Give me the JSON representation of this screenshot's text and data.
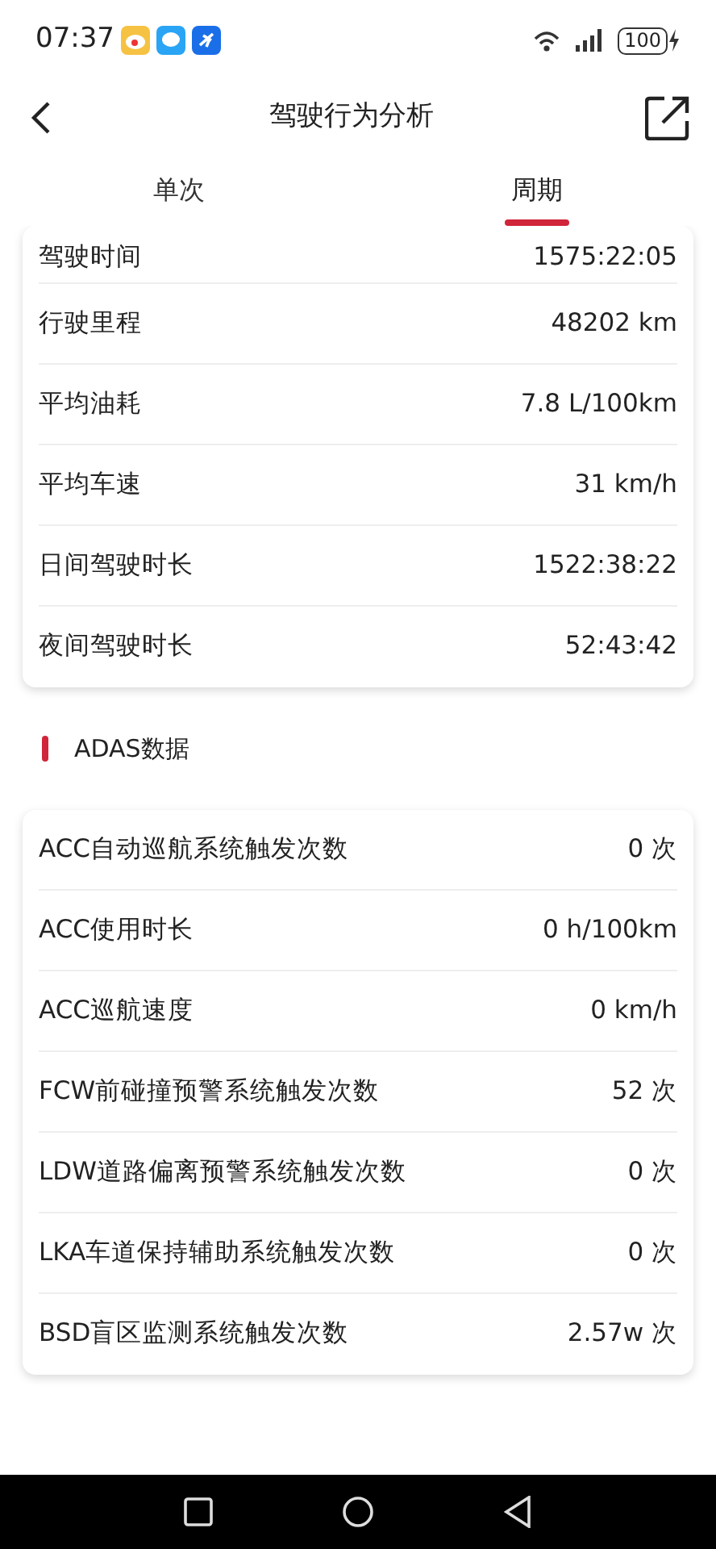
{
  "status_bar": {
    "time": "07:37",
    "battery": "100"
  },
  "header": {
    "title": "驾驶行为分析"
  },
  "tabs": [
    {
      "label": "单次",
      "selected": false
    },
    {
      "label": "周期",
      "selected": true
    }
  ],
  "summary": [
    {
      "label": "驾驶时间",
      "value": "1575:22:05"
    },
    {
      "label": "行驶里程",
      "value": "48202 km"
    },
    {
      "label": "平均油耗",
      "value": "7.8 L/100km"
    },
    {
      "label": "平均车速",
      "value": "31 km/h"
    },
    {
      "label": "日间驾驶时长",
      "value": "1522:38:22"
    },
    {
      "label": "夜间驾驶时长",
      "value": "52:43:42"
    }
  ],
  "adas": {
    "title": "ADAS数据",
    "rows": [
      {
        "label": "ACC自动巡航系统触发次数",
        "value": "0 次"
      },
      {
        "label": "ACC使用时长",
        "value": "0 h/100km"
      },
      {
        "label": "ACC巡航速度",
        "value": "0 km/h"
      },
      {
        "label": "FCW前碰撞预警系统触发次数",
        "value": "52 次"
      },
      {
        "label": "LDW道路偏离预警系统触发次数",
        "value": "0 次"
      },
      {
        "label": "LKA车道保持辅助系统触发次数",
        "value": "0 次"
      },
      {
        "label": "BSD盲区监测系统触发次数",
        "value": "2.57w 次"
      }
    ]
  }
}
